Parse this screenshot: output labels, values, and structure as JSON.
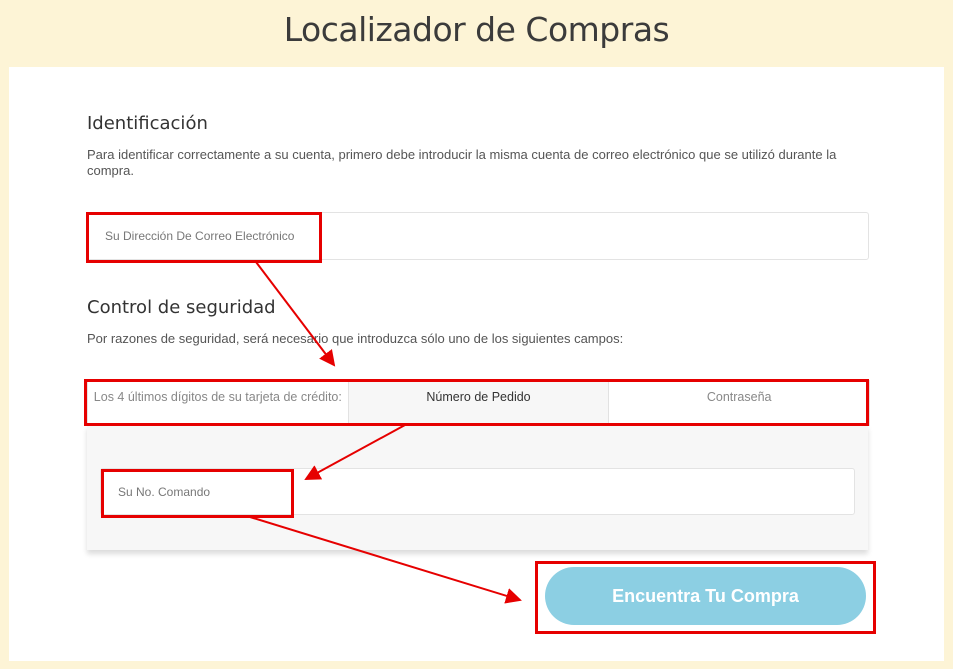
{
  "page": {
    "title": "Localizador de Compras"
  },
  "identification": {
    "heading": "Identificación",
    "description": "Para identificar correctamente a su cuenta, primero debe introducir la misma cuenta de correo electrónico que se utilizó durante la compra.",
    "email_placeholder": "Su Dirección De Correo Electrónico"
  },
  "security": {
    "heading": "Control de seguridad",
    "description": "Por razones de seguridad, será necesario que introduzca sólo uno de los siguientes campos:",
    "tabs": [
      {
        "label": "Los 4 últimos dígitos de su tarjeta de crédito:"
      },
      {
        "label": "Número de Pedido"
      },
      {
        "label": "Contraseña"
      }
    ],
    "active_tab": "Número de Pedido",
    "order_placeholder": "Su No. Comando"
  },
  "submit": {
    "label": "Encuentra Tu Compra"
  },
  "colors": {
    "background": "#fdf4d6",
    "button": "#8ccfe3",
    "annotation": "#e60000"
  }
}
